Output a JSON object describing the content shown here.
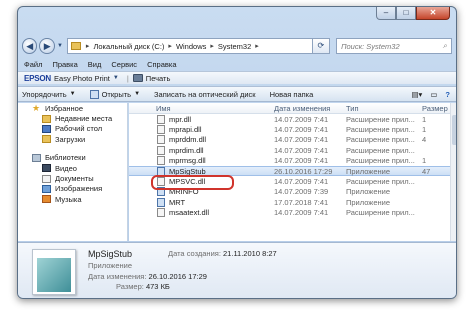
{
  "window": {
    "title": "System32"
  },
  "address": {
    "crumbs": [
      "Локальный диск (C:)",
      "Windows",
      "System32"
    ],
    "search_placeholder": "Поиск: System32"
  },
  "menubar": [
    "Файл",
    "Правка",
    "Вид",
    "Сервис",
    "Справка"
  ],
  "epson": {
    "brand": "EPSON",
    "app": "Easy Photo Print",
    "print": "Печать"
  },
  "commandbar": {
    "organize": "Упорядочить",
    "open": "Открыть",
    "burn": "Записать на оптический диск",
    "new_folder": "Новая папка"
  },
  "nav": {
    "favorites": "Избранное",
    "favorites_items": [
      "Недавние места",
      "Рабочий стол",
      "Загрузки"
    ],
    "libraries": "Библиотеки",
    "libraries_items": [
      "Видео",
      "Документы",
      "Изображения",
      "Музыка"
    ]
  },
  "columns": {
    "name": "Имя",
    "date": "Дата изменения",
    "type": "Тип",
    "size": "Размер"
  },
  "files": [
    {
      "name": "mpr.dll",
      "date": "14.07.2009 7:41",
      "type": "Расширение прил...",
      "size": "1"
    },
    {
      "name": "mprapi.dll",
      "date": "14.07.2009 7:41",
      "type": "Расширение прил...",
      "size": "1"
    },
    {
      "name": "mprddm.dll",
      "date": "14.07.2009 7:41",
      "type": "Расширение прил...",
      "size": "4"
    },
    {
      "name": "mprdim.dll",
      "date": "14.07.2009 7:41",
      "type": "Расширение прил...",
      "size": ""
    },
    {
      "name": "mprmsg.dll",
      "date": "14.07.2009 7:41",
      "type": "Расширение прил...",
      "size": "1"
    },
    {
      "name": "MpSigStub",
      "date": "26.10.2016 17:29",
      "type": "Приложение",
      "size": "47"
    },
    {
      "name": "MPSVC.dll",
      "date": "14.07.2009 7:41",
      "type": "Расширение прил...",
      "size": ""
    },
    {
      "name": "MRINFO",
      "date": "14.07.2009 7:39",
      "type": "Приложение",
      "size": ""
    },
    {
      "name": "MRT",
      "date": "17.07.2018 7:41",
      "type": "Приложение",
      "size": ""
    },
    {
      "name": "msaatext.dll",
      "date": "14.07.2009 7:41",
      "type": "Расширение прил...",
      "size": ""
    }
  ],
  "details": {
    "name": "MpSigStub",
    "type": "Приложение",
    "created_label": "Дата создания:",
    "created": "21.11.2010 8:27",
    "modified_label": "Дата изменения:",
    "modified": "26.10.2016 17:29",
    "size_label": "Размер:",
    "size": "473 КБ"
  },
  "colors": {
    "selection": "#cddff5",
    "highlight_ring": "#d0342c",
    "chrome": "#b4cbe7"
  }
}
